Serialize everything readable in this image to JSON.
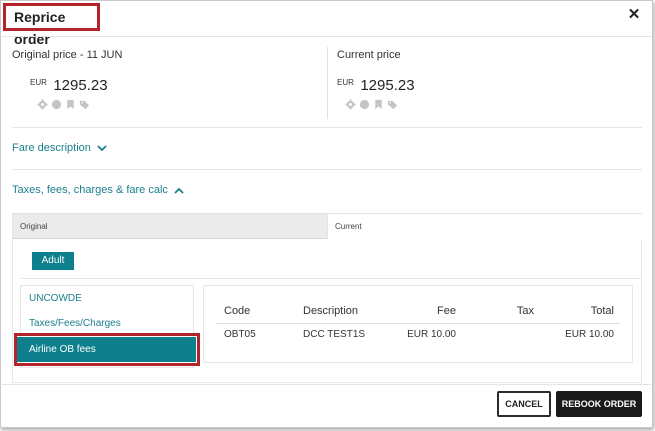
{
  "dialog": {
    "title": "Reprice order",
    "close_icon": "close-icon"
  },
  "prices": {
    "original": {
      "label": "Original price - 11 JUN",
      "currency": "EUR",
      "amount": "1295.23"
    },
    "current": {
      "label": "Current price",
      "currency": "EUR",
      "amount": "1295.23"
    },
    "icons": [
      "gear-icon",
      "circle-icon",
      "bookmark-icon",
      "tag-icon"
    ]
  },
  "sections": {
    "fare_description": "Fare description",
    "taxes_fees": "Taxes, fees, charges & fare calc"
  },
  "tabs": {
    "original": "Original",
    "current": "Current"
  },
  "passenger_type": "Adult",
  "list": {
    "items": [
      "UNCOWDE",
      "Taxes/Fees/Charges",
      "Airline OB fees"
    ],
    "selected_index": 2
  },
  "fee_table": {
    "headers": {
      "code": "Code",
      "description": "Description",
      "fee": "Fee",
      "tax": "Tax",
      "total": "Total"
    },
    "rows": [
      {
        "code": "OBT05",
        "description": "DCC TEST1S",
        "fee": "EUR 10.00",
        "tax": "",
        "total": "EUR 10.00"
      }
    ]
  },
  "footer": {
    "cancel": "CANCEL",
    "rebook": "REBOOK ORDER"
  },
  "colors": {
    "accent": "#0e7f8c",
    "link": "#1a7f8e",
    "highlight_border": "#b3232b",
    "primary_button": "#1a1a1a"
  }
}
